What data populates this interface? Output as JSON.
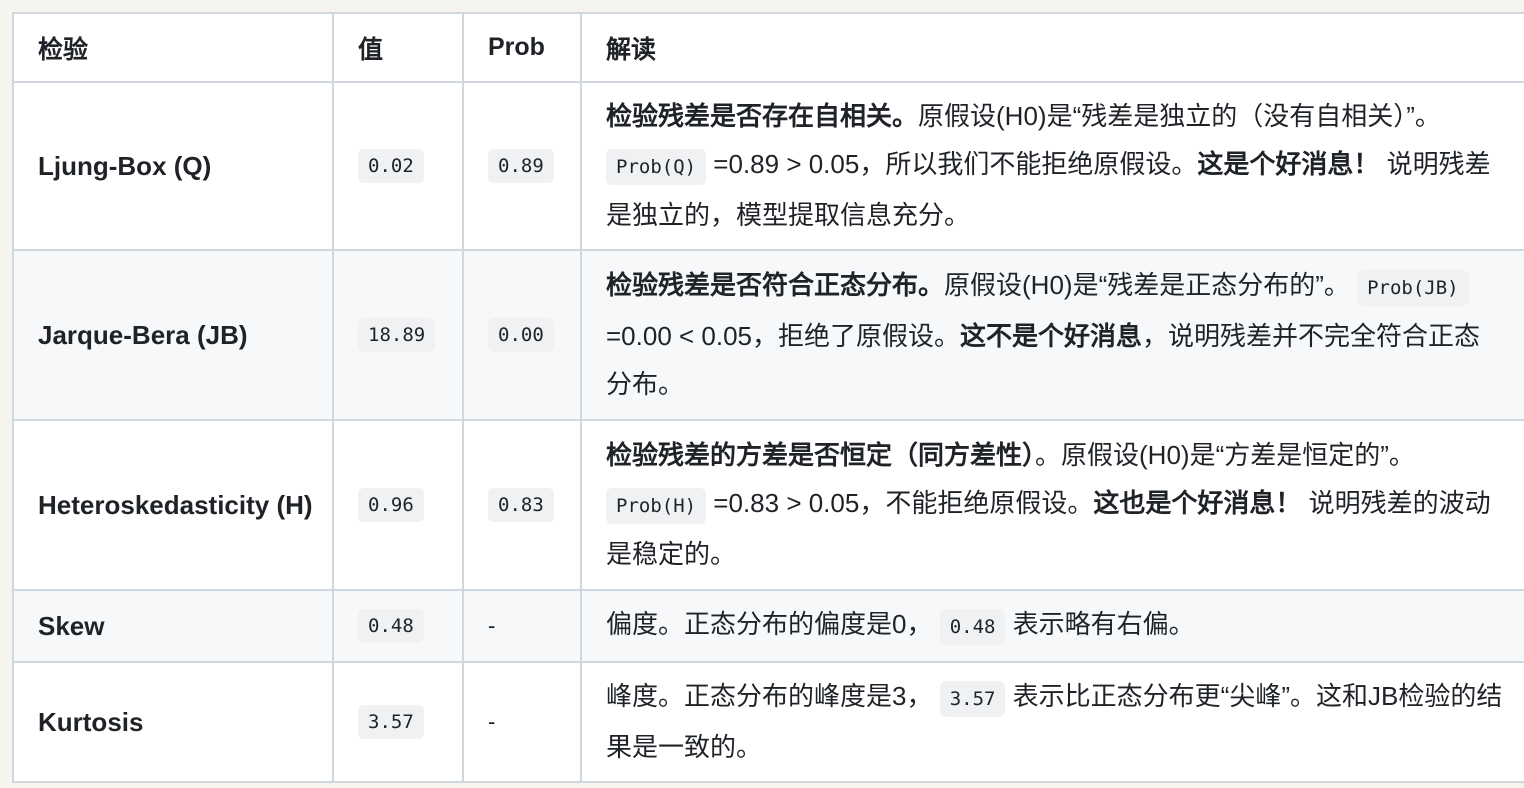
{
  "headers": {
    "test": "检验",
    "value": "值",
    "prob": "Prob",
    "interp": "解读"
  },
  "rows": [
    {
      "test": "Ljung-Box (Q)",
      "value": "0.02",
      "prob": "0.89",
      "interp": [
        {
          "t": "b",
          "v": "检验残差是否存在自相关。"
        },
        {
          "t": "s",
          "v": "原假设(H0)是“残差是独立的（没有自相关）”。 "
        },
        {
          "t": "c",
          "v": "Prob(Q)"
        },
        {
          "t": "s",
          "v": " =0.89 > 0.05，所以我们不能拒绝原假设。"
        },
        {
          "t": "b",
          "v": "这是个好消息！"
        },
        {
          "t": "s",
          "v": " 说明残差是独立的，模型提取信息充分。"
        }
      ]
    },
    {
      "test": "Jarque-Bera (JB)",
      "value": "18.89",
      "prob": "0.00",
      "interp": [
        {
          "t": "b",
          "v": "检验残差是否符合正态分布。"
        },
        {
          "t": "s",
          "v": "原假设(H0)是“残差是正态分布的”。 "
        },
        {
          "t": "c",
          "v": "Prob(JB)"
        },
        {
          "t": "s",
          "v": " =0.00 < 0.05，拒绝了原假设。"
        },
        {
          "t": "b",
          "v": "这不是个好消息"
        },
        {
          "t": "s",
          "v": "，说明残差并不完全符合正态分布。"
        }
      ]
    },
    {
      "test": "Heteroskedasticity (H)",
      "value": "0.96",
      "prob": "0.83",
      "interp": [
        {
          "t": "b",
          "v": "检验残差的方差是否恒定（同方差性）"
        },
        {
          "t": "s",
          "v": "。原假设(H0)是“方差是恒定的”。 "
        },
        {
          "t": "c",
          "v": "Prob(H)"
        },
        {
          "t": "s",
          "v": " =0.83 > 0.05，不能拒绝原假设。"
        },
        {
          "t": "b",
          "v": "这也是个好消息！"
        },
        {
          "t": "s",
          "v": " 说明残差的波动是稳定的。"
        }
      ]
    },
    {
      "test": "Skew",
      "value": "0.48",
      "prob": "-",
      "interp": [
        {
          "t": "s",
          "v": "偏度。正态分布的偏度是0， "
        },
        {
          "t": "c",
          "v": "0.48"
        },
        {
          "t": "s",
          "v": " 表示略有右偏。"
        }
      ]
    },
    {
      "test": "Kurtosis",
      "value": "3.57",
      "prob": "-",
      "interp": [
        {
          "t": "s",
          "v": "峰度。正态分布的峰度是3， "
        },
        {
          "t": "c",
          "v": "3.57"
        },
        {
          "t": "s",
          "v": " 表示比正态分布更“尖峰”。这和JB检验的结果是一致的。"
        }
      ]
    }
  ]
}
